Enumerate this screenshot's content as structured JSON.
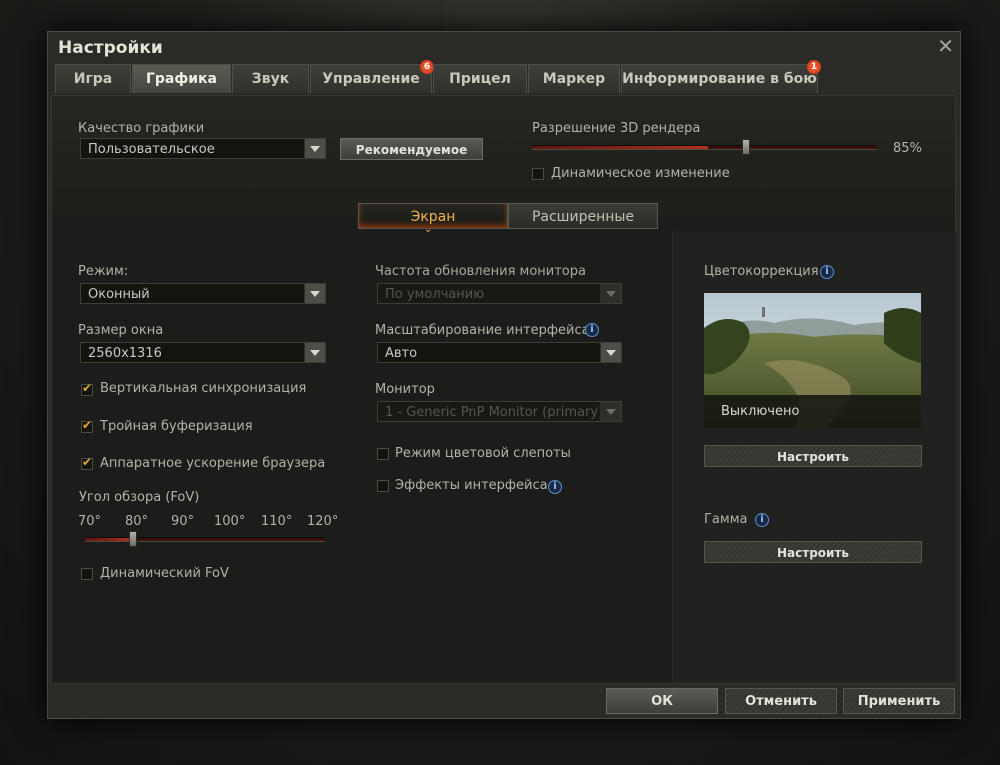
{
  "window": {
    "title": "Настройки"
  },
  "tabs": [
    {
      "label": "Игра",
      "active": false
    },
    {
      "label": "Графика",
      "active": true
    },
    {
      "label": "Звук",
      "active": false
    },
    {
      "label": "Управление",
      "active": false,
      "badge": "6"
    },
    {
      "label": "Прицел",
      "active": false
    },
    {
      "label": "Маркер",
      "active": false
    },
    {
      "label": "Информирование в бою",
      "active": false,
      "badge": "1"
    }
  ],
  "quality": {
    "label": "Качество графики",
    "value": "Пользовательское",
    "recommended_label": "Рекомендуемое"
  },
  "resolution3d": {
    "label": "Разрешение 3D рендера",
    "value_text": "85%",
    "value": 0.85,
    "dynamic_label": "Динамическое изменение",
    "dynamic_checked": false
  },
  "subtabs": [
    {
      "label": "Экран",
      "active": true
    },
    {
      "label": "Расширенные",
      "active": false
    }
  ],
  "left": {
    "mode_label": "Режим:",
    "mode_value": "Оконный",
    "size_label": "Размер окна",
    "size_value": "2560x1316",
    "vsync_label": "Вертикальная синхронизация",
    "vsync_checked": true,
    "triple_label": "Тройная буферизация",
    "triple_checked": true,
    "browser_label": "Аппаратное ускорение браузера",
    "browser_checked": true,
    "fov_label": "Угол обзора (FoV)",
    "fov_ticks": [
      "70°",
      "80°",
      "90°",
      "100°",
      "110°",
      "120°"
    ],
    "fov_value": "80°",
    "dynfov_label": "Динамический FoV",
    "dynfov_checked": false
  },
  "middle": {
    "refresh_label": "Частота обновления монитора",
    "refresh_value": "По умолчанию",
    "scale_label": "Масштабирование интерфейса",
    "scale_value": "Авто",
    "monitor_label": "Монитор",
    "monitor_value": "1 - Generic PnP Monitor (primary)",
    "colorblind_label": "Режим цветовой слепоты",
    "colorblind_checked": false,
    "effects_label": "Эффекты интерфейса",
    "effects_checked": false
  },
  "right": {
    "color_label": "Цветокоррекция",
    "color_status": "Выключено",
    "color_button": "Настроить",
    "gamma_label": "Гамма",
    "gamma_button": "Настроить"
  },
  "footer": {
    "ok": "ОК",
    "cancel": "Отменить",
    "apply": "Применить"
  },
  "colors": {
    "accent": "#f2b24a",
    "badge": "#d8341a",
    "slider_fill": "#b0301f"
  }
}
